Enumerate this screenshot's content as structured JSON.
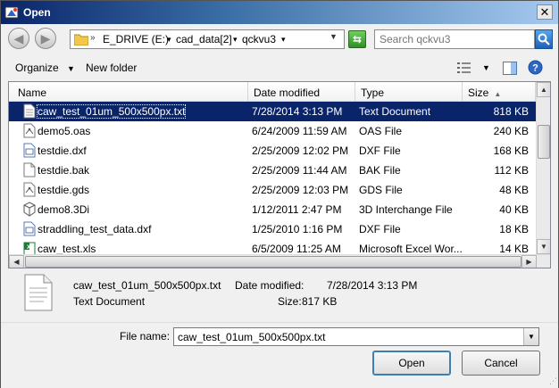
{
  "window": {
    "title": "Open"
  },
  "address": {
    "crumbs": [
      "E_DRIVE (E:)",
      "cad_data[2]",
      "qckvu3"
    ],
    "search_placeholder": "Search qckvu3"
  },
  "toolbar": {
    "organize": "Organize",
    "new_folder": "New folder"
  },
  "columns": {
    "name": "Name",
    "date": "Date modified",
    "type": "Type",
    "size": "Size"
  },
  "files": [
    {
      "name": "caw_test_01um_500x500px.txt",
      "date": "7/28/2014 3:13 PM",
      "type": "Text Document",
      "size": "818 KB",
      "selected": true,
      "icon": "text-file-icon"
    },
    {
      "name": "demo5.oas",
      "date": "6/24/2009 11:59 AM",
      "type": "OAS File",
      "size": "240 KB",
      "selected": false,
      "icon": "cad-file-icon"
    },
    {
      "name": "testdie.dxf",
      "date": "2/25/2009 12:02 PM",
      "type": "DXF File",
      "size": "168 KB",
      "selected": false,
      "icon": "dxf-file-icon"
    },
    {
      "name": "testdie.bak",
      "date": "2/25/2009 11:44 AM",
      "type": "BAK File",
      "size": "112 KB",
      "selected": false,
      "icon": "blank-file-icon"
    },
    {
      "name": "testdie.gds",
      "date": "2/25/2009 12:03 PM",
      "type": "GDS File",
      "size": "48 KB",
      "selected": false,
      "icon": "cad-file-icon"
    },
    {
      "name": "demo8.3Di",
      "date": "1/12/2011 2:47 PM",
      "type": "3D Interchange File",
      "size": "40 KB",
      "selected": false,
      "icon": "cube-icon"
    },
    {
      "name": "straddling_test_data.dxf",
      "date": "1/25/2010 1:16 PM",
      "type": "DXF File",
      "size": "18 KB",
      "selected": false,
      "icon": "dxf-file-icon"
    },
    {
      "name": "caw_test.xls",
      "date": "6/5/2009 11:25 AM",
      "type": "Microsoft Excel Wor...",
      "size": "14 KB",
      "selected": false,
      "icon": "excel-file-icon"
    }
  ],
  "details": {
    "name": "caw_test_01um_500x500px.txt",
    "type": "Text Document",
    "date_label": "Date modified:",
    "date_value": "7/28/2014 3:13 PM",
    "size_label": "Size:",
    "size_value": "817 KB"
  },
  "bottom": {
    "file_name_label": "File name:",
    "file_name_value": "caw_test_01um_500x500px.txt",
    "open_label": "Open",
    "cancel_label": "Cancel"
  },
  "icons": {
    "back": "back-arrow-icon",
    "forward": "forward-arrow-icon",
    "search": "magnifier-icon",
    "help": "help-icon"
  },
  "colors": {
    "selection": "#0a246a",
    "title_start": "#0a246a",
    "title_end": "#a6caf0"
  }
}
